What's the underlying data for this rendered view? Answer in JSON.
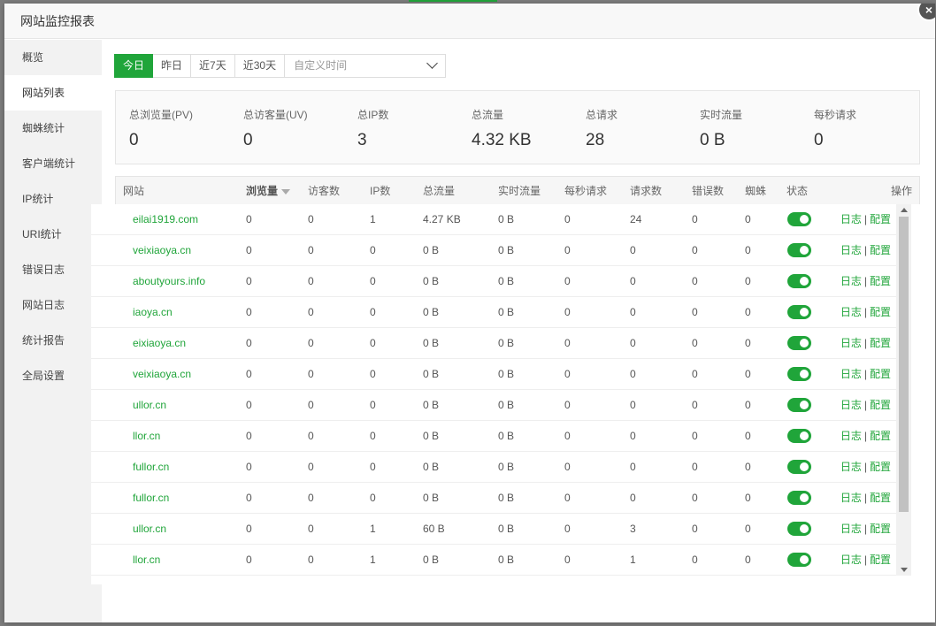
{
  "dialog": {
    "title": "网站监控报表",
    "close_icon": "×"
  },
  "sidebar": {
    "items": [
      {
        "label": "概览"
      },
      {
        "label": "网站列表"
      },
      {
        "label": "蜘蛛统计"
      },
      {
        "label": "客户端统计"
      },
      {
        "label": "IP统计"
      },
      {
        "label": "URI统计"
      },
      {
        "label": "错误日志"
      },
      {
        "label": "网站日志"
      },
      {
        "label": "统计报告"
      },
      {
        "label": "全局设置"
      }
    ],
    "active": "网站列表"
  },
  "toolbar": {
    "today": "今日",
    "yesterday": "昨日",
    "last7": "近7天",
    "last30": "近30天",
    "custom_placeholder": "自定义时间"
  },
  "stats": [
    {
      "label": "总浏览量(PV)",
      "value": "0"
    },
    {
      "label": "总访客量(UV)",
      "value": "0"
    },
    {
      "label": "总IP数",
      "value": "3"
    },
    {
      "label": "总流量",
      "value": "4.32 KB"
    },
    {
      "label": "总请求",
      "value": "28"
    },
    {
      "label": "实时流量",
      "value": "0 B"
    },
    {
      "label": "每秒请求",
      "value": "0"
    }
  ],
  "table": {
    "headers": {
      "site": "网站",
      "pv": "浏览量",
      "uv": "访客数",
      "ip": "IP数",
      "traffic": "总流量",
      "realtime": "实时流量",
      "qps": "每秒请求",
      "requests": "请求数",
      "errors": "错误数",
      "spider": "蜘蛛",
      "status": "状态",
      "ops": "操作"
    },
    "op_log": "日志",
    "op_sep": "|",
    "op_config": "配置",
    "rows": [
      {
        "site": "eilai1919.com",
        "pv": "0",
        "uv": "0",
        "ip": "1",
        "traffic": "4.27 KB",
        "realtime": "0 B",
        "qps": "0",
        "requests": "24",
        "errors": "0",
        "spider": "0"
      },
      {
        "site": "veixiaoya.cn",
        "pv": "0",
        "uv": "0",
        "ip": "0",
        "traffic": "0 B",
        "realtime": "0 B",
        "qps": "0",
        "requests": "0",
        "errors": "0",
        "spider": "0"
      },
      {
        "site": "aboutyours.info",
        "pv": "0",
        "uv": "0",
        "ip": "0",
        "traffic": "0 B",
        "realtime": "0 B",
        "qps": "0",
        "requests": "0",
        "errors": "0",
        "spider": "0"
      },
      {
        "site": "iaoya.cn",
        "pv": "0",
        "uv": "0",
        "ip": "0",
        "traffic": "0 B",
        "realtime": "0 B",
        "qps": "0",
        "requests": "0",
        "errors": "0",
        "spider": "0"
      },
      {
        "site": "eixiaoya.cn",
        "pv": "0",
        "uv": "0",
        "ip": "0",
        "traffic": "0 B",
        "realtime": "0 B",
        "qps": "0",
        "requests": "0",
        "errors": "0",
        "spider": "0"
      },
      {
        "site": "veixiaoya.cn",
        "pv": "0",
        "uv": "0",
        "ip": "0",
        "traffic": "0 B",
        "realtime": "0 B",
        "qps": "0",
        "requests": "0",
        "errors": "0",
        "spider": "0"
      },
      {
        "site": "ullor.cn",
        "pv": "0",
        "uv": "0",
        "ip": "0",
        "traffic": "0 B",
        "realtime": "0 B",
        "qps": "0",
        "requests": "0",
        "errors": "0",
        "spider": "0"
      },
      {
        "site": "llor.cn",
        "pv": "0",
        "uv": "0",
        "ip": "0",
        "traffic": "0 B",
        "realtime": "0 B",
        "qps": "0",
        "requests": "0",
        "errors": "0",
        "spider": "0"
      },
      {
        "site": "fullor.cn",
        "pv": "0",
        "uv": "0",
        "ip": "0",
        "traffic": "0 B",
        "realtime": "0 B",
        "qps": "0",
        "requests": "0",
        "errors": "0",
        "spider": "0"
      },
      {
        "site": "fullor.cn",
        "pv": "0",
        "uv": "0",
        "ip": "0",
        "traffic": "0 B",
        "realtime": "0 B",
        "qps": "0",
        "requests": "0",
        "errors": "0",
        "spider": "0"
      },
      {
        "site": "ullor.cn",
        "pv": "0",
        "uv": "0",
        "ip": "1",
        "traffic": "60 B",
        "realtime": "0 B",
        "qps": "0",
        "requests": "3",
        "errors": "0",
        "spider": "0"
      },
      {
        "site": "llor.cn",
        "pv": "0",
        "uv": "0",
        "ip": "1",
        "traffic": "0 B",
        "realtime": "0 B",
        "qps": "0",
        "requests": "1",
        "errors": "0",
        "spider": "0"
      }
    ]
  },
  "colors": {
    "accent": "#20a53a"
  }
}
